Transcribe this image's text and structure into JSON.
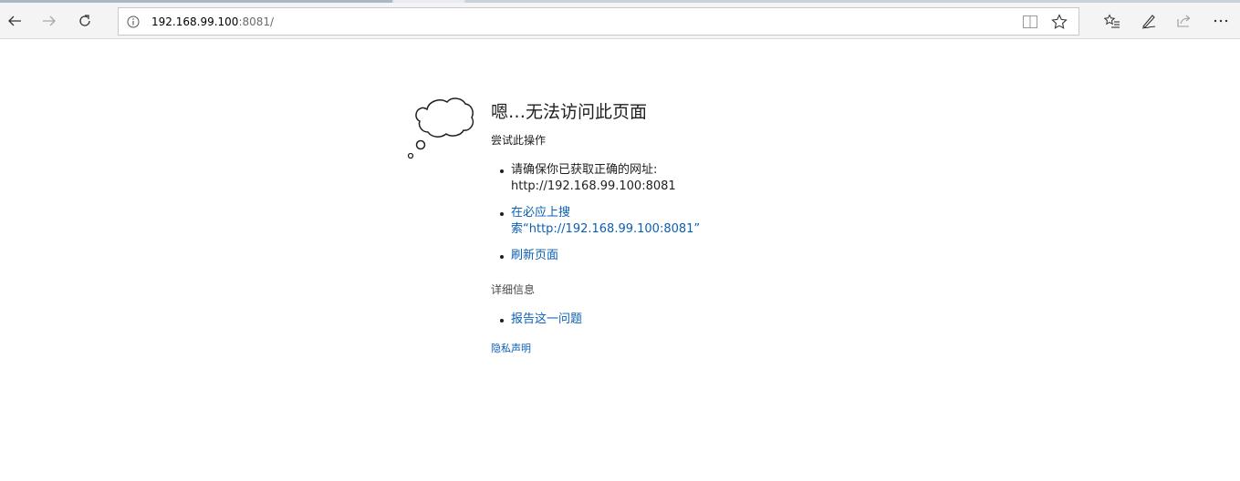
{
  "browser": {
    "address": {
      "host": "192.168.99.100",
      "port_path": ":8081/"
    },
    "icons": {
      "back": "back-arrow-icon",
      "forward": "forward-arrow-icon",
      "refresh": "refresh-icon",
      "info": "info-icon",
      "reader": "reading-view-icon",
      "favorite": "star-icon",
      "favorites_hub": "favorites-list-icon",
      "notes": "pen-icon",
      "share": "share-icon",
      "more": "more-icon"
    }
  },
  "error_page": {
    "title": "嗯…无法访问此页面",
    "subtitle": "尝试此操作",
    "suggestions": [
      {
        "line1": "请确保你已获取正确的网址:",
        "line2": "http://192.168.99.100:8081"
      },
      {
        "line1": "在必应上搜",
        "line2": "索“http://192.168.99.100:8081”"
      },
      {
        "line1": "刷新页面"
      }
    ],
    "details_label": "详细信息",
    "report_link": "报告这一问题",
    "privacy_link": "隐私声明"
  },
  "colors": {
    "link": "#0a5fb4",
    "toolbar_bg": "#f4f4f4"
  }
}
